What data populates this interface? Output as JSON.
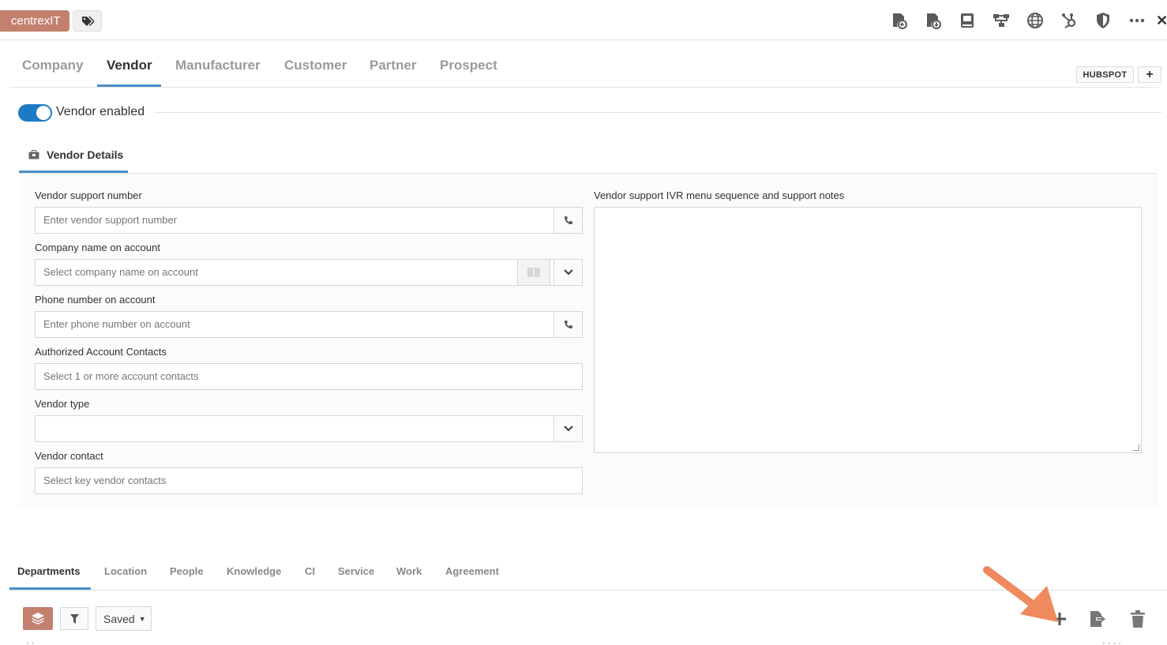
{
  "header": {
    "brand": "centrexIT",
    "icons": [
      "tag-icon",
      "record-back-icon",
      "record-save-icon",
      "book-icon",
      "sitemap-icon",
      "globe-icon",
      "hubspot-icon",
      "shield-icon",
      "more-icon",
      "close-icon"
    ]
  },
  "tabs": [
    "Company",
    "Vendor",
    "Manufacturer",
    "Customer",
    "Partner",
    "Prospect"
  ],
  "active_tab": "Vendor",
  "actions": {
    "hubspot": "HUBSPOT",
    "add": "+"
  },
  "toggle": {
    "label": "Vendor enabled",
    "on": true
  },
  "section": {
    "title": "Vendor Details"
  },
  "form": {
    "support_number": {
      "label": "Vendor support number",
      "placeholder": "Enter vendor support number"
    },
    "company_name": {
      "label": "Company name on account",
      "placeholder": "Select company name on account"
    },
    "phone_number": {
      "label": "Phone number on account",
      "placeholder": "Enter phone number on account"
    },
    "authorized_contacts": {
      "label": "Authorized Account Contacts",
      "placeholder": "Select 1 or more account contacts"
    },
    "vendor_type": {
      "label": "Vendor type",
      "value": ""
    },
    "vendor_contact": {
      "label": "Vendor contact",
      "placeholder": "Select key vendor contacts"
    },
    "notes": {
      "label": "Vendor support IVR menu sequence and support notes",
      "value": ""
    }
  },
  "bottom_tabs": [
    "Departments",
    "Location",
    "People",
    "Knowledge",
    "CI",
    "Service",
    "Work",
    "Agreement"
  ],
  "active_bottom_tab": "Departments",
  "toolbar": {
    "saved": "Saved"
  },
  "colors": {
    "brand": "#c4806f",
    "accent": "#1b7bc4",
    "tab_underline": "#4a90c8",
    "annotation_arrow": "#ef8a5e"
  }
}
